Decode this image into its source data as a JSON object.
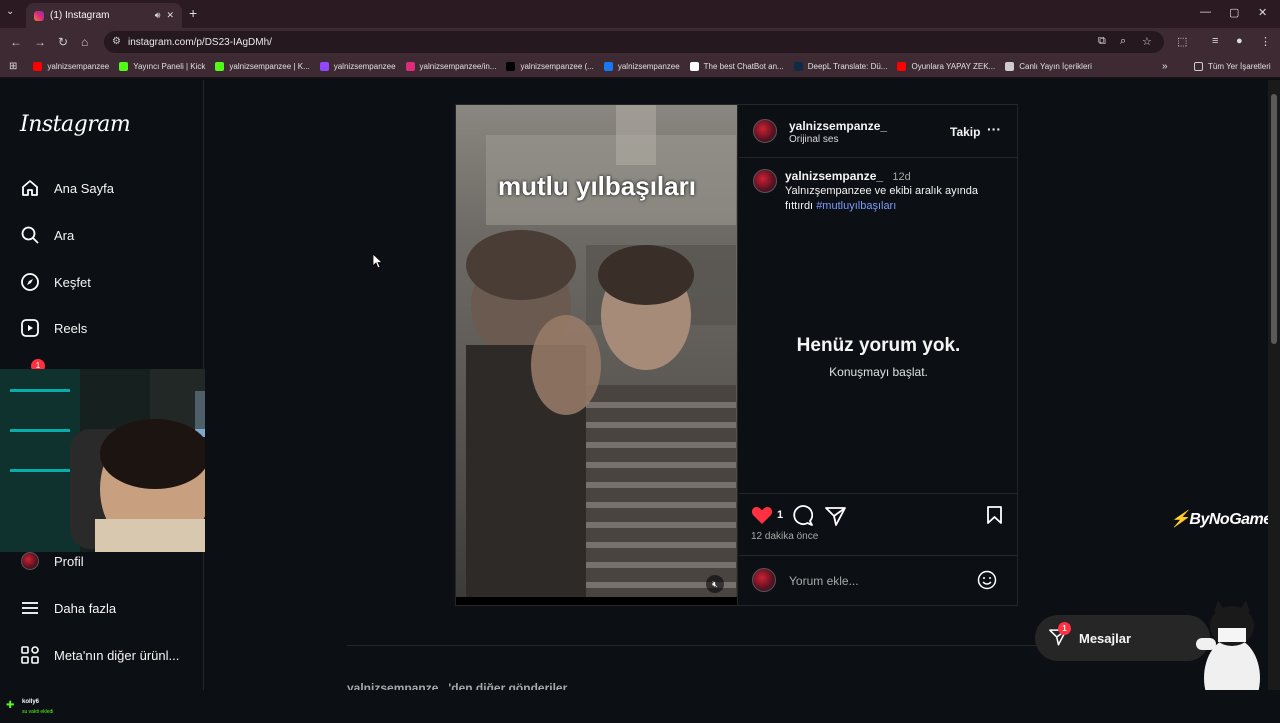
{
  "browser": {
    "tab_title": "(1) Instagram",
    "url": "instagram.com/p/DS23-IAgDMh/",
    "bookmarks": [
      {
        "label": "yalnizsempanzee",
        "color": "#ff0000"
      },
      {
        "label": "Yayıncı Paneli | Kick",
        "color": "#53fc18"
      },
      {
        "label": "yalnizsempanzee | K...",
        "color": "#53fc18"
      },
      {
        "label": "yalnizsempanzee",
        "color": "#9146ff"
      },
      {
        "label": "yalnizsempanzee/in...",
        "color": "#dd2a7b"
      },
      {
        "label": "yalnizsempanzee (...",
        "color": "#000000"
      },
      {
        "label": "yalnizsempanzee",
        "color": "#1877f2"
      },
      {
        "label": "The best ChatBot an...",
        "color": "#ffffff"
      },
      {
        "label": "DeepL Translate: Dü...",
        "color": "#0f2b46"
      },
      {
        "label": "Oyunlara YAPAY ZEK...",
        "color": "#ff0000"
      },
      {
        "label": "Canlı Yayın İçerikleri",
        "color": "#cccccc"
      }
    ],
    "all_bookmarks": "Tüm Yer İşaretleri"
  },
  "sidebar": {
    "logo": "Instagram",
    "items": [
      {
        "label": "Ana Sayfa",
        "icon": "home-icon"
      },
      {
        "label": "Ara",
        "icon": "search-icon"
      },
      {
        "label": "Keşfet",
        "icon": "compass-icon"
      },
      {
        "label": "Reels",
        "icon": "reels-icon"
      },
      {
        "label": "Profil",
        "icon": "avatar"
      },
      {
        "label": "Daha fazla",
        "icon": "menu-icon"
      },
      {
        "label": "Meta'nın diğer ürünl...",
        "icon": "apps-icon"
      }
    ],
    "notification_badge": "1"
  },
  "post": {
    "video_caption": "mutlu yılbaşıları",
    "username": "yalnizsempanze_",
    "audio": "Orijinal ses",
    "follow_label": "Takip",
    "comment_username": "yalnizsempanze_",
    "comment_time": "12d",
    "caption": "Yalnızşempanzee ve ekibi aralık ayında fıttırdı",
    "hashtag": "#mutluyılbaşıları",
    "no_comments_title": "Henüz yorum yok.",
    "no_comments_sub": "Konuşmayı başlat.",
    "likes": "1",
    "posted": "12 dakika önce",
    "comment_placeholder": "Yorum ekle..."
  },
  "more_posts": "yalnizsempanze_ 'den diğer gönderiler",
  "messages": {
    "label": "Mesajlar",
    "badge": "1"
  },
  "watermark": "ByNoGame",
  "stream_bar": {
    "user": "kolly6",
    "status": "su vakti ekledi"
  },
  "colors": {
    "accent_blue": "#7a9cff",
    "like_red": "#ff3040"
  }
}
